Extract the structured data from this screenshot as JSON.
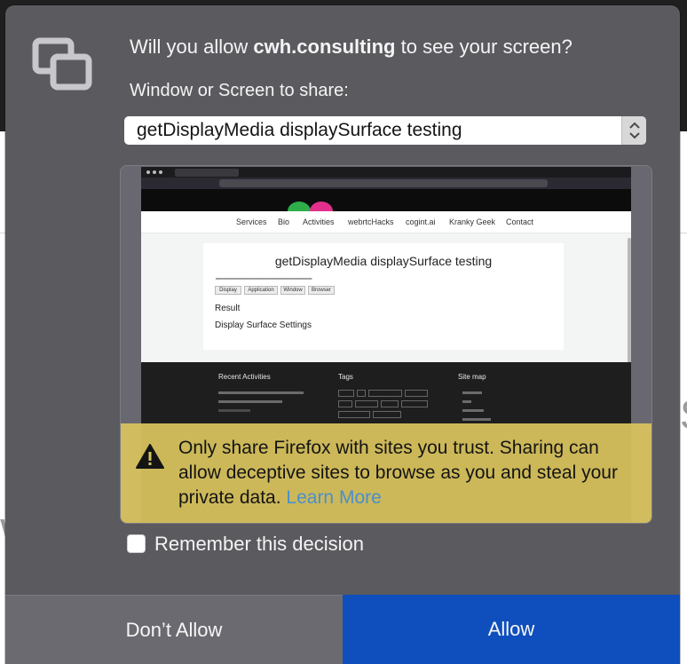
{
  "dialog": {
    "title_prefix": "Will you allow ",
    "title_site": "cwh.consulting",
    "title_suffix": " to see your screen?",
    "share_label": "Window or Screen to share:",
    "selected_source": "getDisplayMedia displaySurface testing",
    "warning_text": "Only share Firefox with sites you trust. Sharing can allow deceptive sites to browse as you and steal your private data. ",
    "warning_link": "Learn More",
    "remember_label": "Remember this decision",
    "remember_checked": false,
    "dont_allow_label": "Don’t Allow",
    "allow_label": "Allow"
  },
  "preview": {
    "nav_items": [
      "Services",
      "Bio",
      "Activities",
      "webrtcHacks",
      "cogint.ai",
      "Kranky Geek",
      "Contact"
    ],
    "card_title": "getDisplayMedia displaySurface testing",
    "card_buttons": [
      "Display",
      "Application",
      "Window",
      "Browser"
    ],
    "result_label": "Result",
    "settings_label": "Display Surface Settings",
    "footer_headings": [
      "Recent Activities",
      "Tags",
      "Site map"
    ]
  },
  "colors": {
    "panel": "#5b5a5f",
    "allow_button": "#0f4fbd",
    "dont_allow_button": "#6b6a70",
    "warning_background": "#d9c45e",
    "link": "#4a8fcc"
  },
  "icons": {
    "share": "screen-share-icon",
    "warning": "warning-triangle-icon",
    "dropdown": "updown-chevron-icon"
  }
}
